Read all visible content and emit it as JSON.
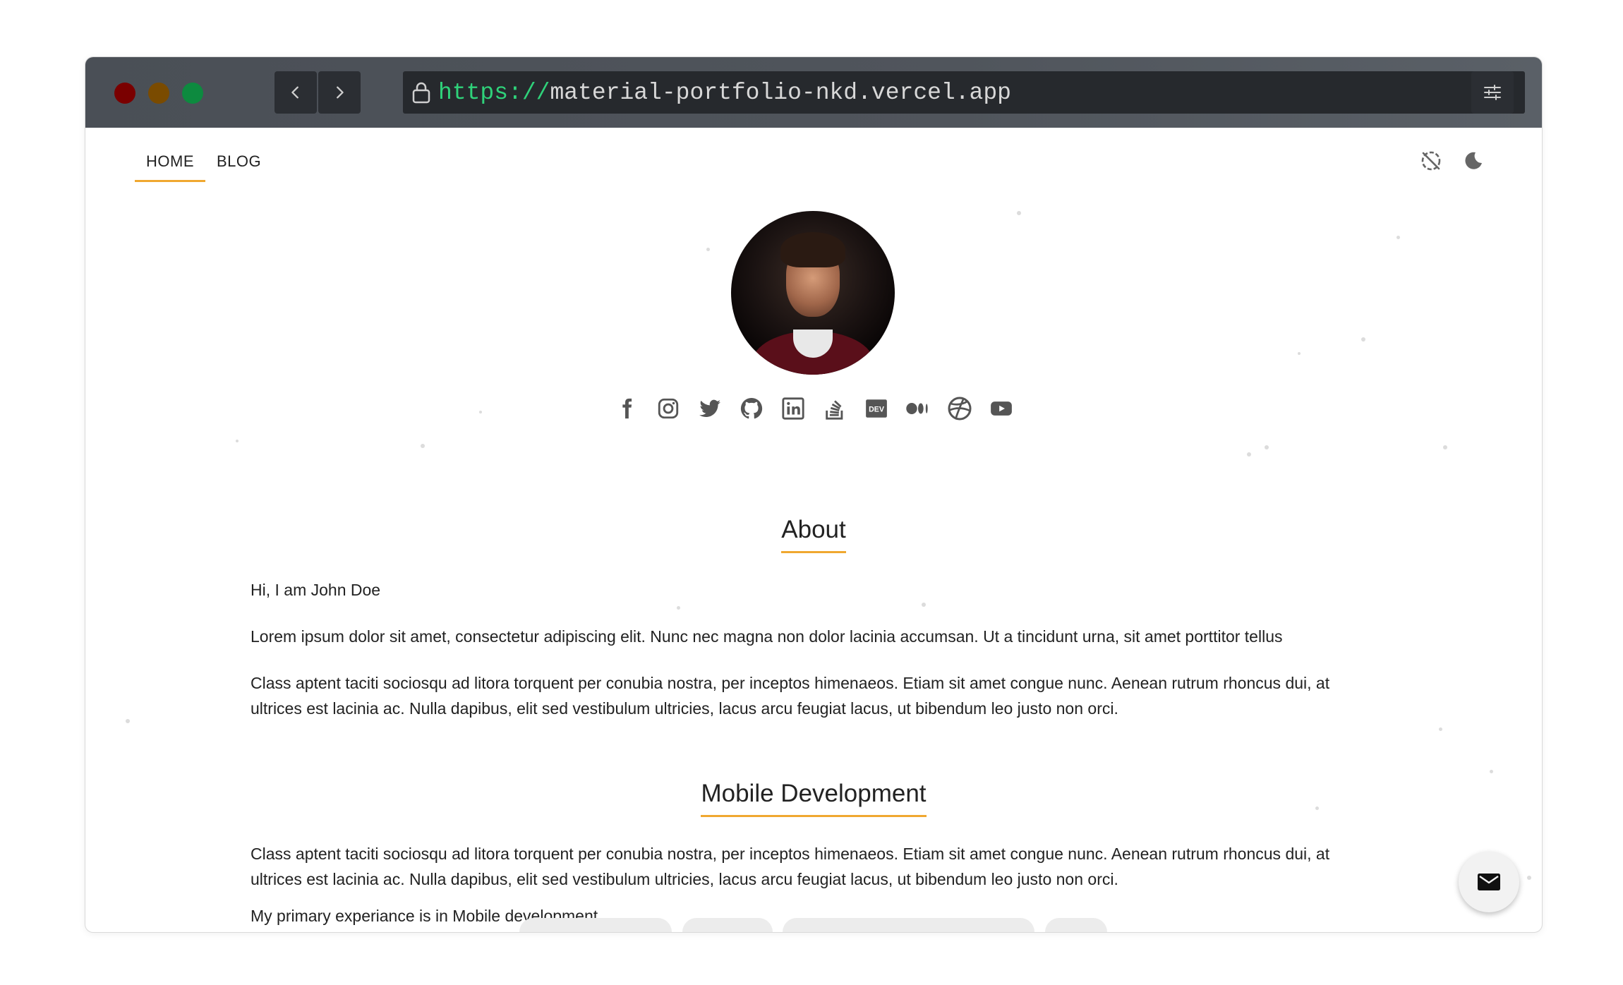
{
  "browser": {
    "url_scheme": "https://",
    "url_host": "material-portfolio-nkd.vercel.app"
  },
  "nav": {
    "items": [
      {
        "label": "HOME",
        "active": true
      },
      {
        "label": "BLOG",
        "active": false
      }
    ]
  },
  "header_icons": [
    "animation-off-icon",
    "dark-mode-moon-icon"
  ],
  "socials": [
    "facebook-icon",
    "instagram-icon",
    "twitter-icon",
    "github-icon",
    "linkedin-icon",
    "stackoverflow-icon",
    "dev-icon",
    "medium-icon",
    "dribbble-icon",
    "youtube-icon"
  ],
  "about": {
    "title": "About",
    "greeting": "Hi, I am John Doe",
    "p1": "Lorem ipsum dolor sit amet, consectetur adipiscing elit. Nunc nec magna non dolor lacinia accumsan. Ut a tincidunt urna, sit amet porttitor tellus",
    "p2": "Class aptent taciti sociosqu ad litora torquent per conubia nostra, per inceptos himenaeos. Etiam sit amet congue nunc. Aenean rutrum rhoncus dui, at ultrices est lacinia ac. Nulla dapibus, elit sed vestibulum ultricies, lacus arcu feugiat lacus, ut bibendum leo justo non orci."
  },
  "mobile": {
    "title": "Mobile Development",
    "p1": "Class aptent taciti sociosqu ad litora torquent per conubia nostra, per inceptos himenaeos. Etiam sit amet congue nunc. Aenean rutrum rhoncus dui, at ultrices est lacinia ac. Nulla dapibus, elit sed vestibulum ultricies, lacus arcu feugiat lacus, ut bibendum leo justo non orci.",
    "p2": "My primary experiance is in Mobile development."
  },
  "colors": {
    "accent": "#f0a830",
    "url_scheme": "#2fd27a",
    "titlebar": "#4a4f56"
  },
  "fab": {
    "icon": "mail-icon"
  }
}
